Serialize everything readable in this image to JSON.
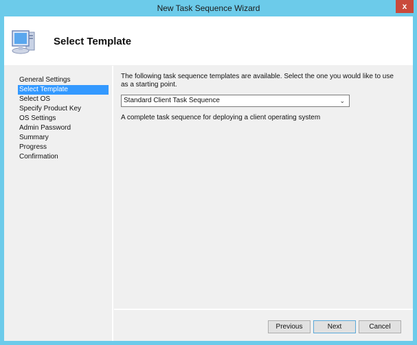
{
  "window": {
    "title": "New Task Sequence Wizard",
    "close_label": "x"
  },
  "header": {
    "title": "Select Template",
    "icon": "computer-icon"
  },
  "sidebar": {
    "items": [
      {
        "label": "General Settings",
        "active": false
      },
      {
        "label": "Select Template",
        "active": true
      },
      {
        "label": "Select OS",
        "active": false
      },
      {
        "label": "Specify Product Key",
        "active": false
      },
      {
        "label": "OS Settings",
        "active": false
      },
      {
        "label": "Admin Password",
        "active": false
      },
      {
        "label": "Summary",
        "active": false
      },
      {
        "label": "Progress",
        "active": false
      },
      {
        "label": "Confirmation",
        "active": false
      }
    ]
  },
  "main": {
    "description": "The following task sequence templates are available.  Select the one you would like to use as a starting point.",
    "template_select": {
      "value": "Standard Client Task Sequence",
      "chevron": "⌄"
    },
    "template_description": "A complete task sequence for deploying a client operating system"
  },
  "buttons": {
    "previous": "Previous",
    "next": "Next",
    "cancel": "Cancel"
  },
  "colors": {
    "accent": "#6ccbea",
    "selection": "#3399ff",
    "close": "#c94a3c"
  }
}
